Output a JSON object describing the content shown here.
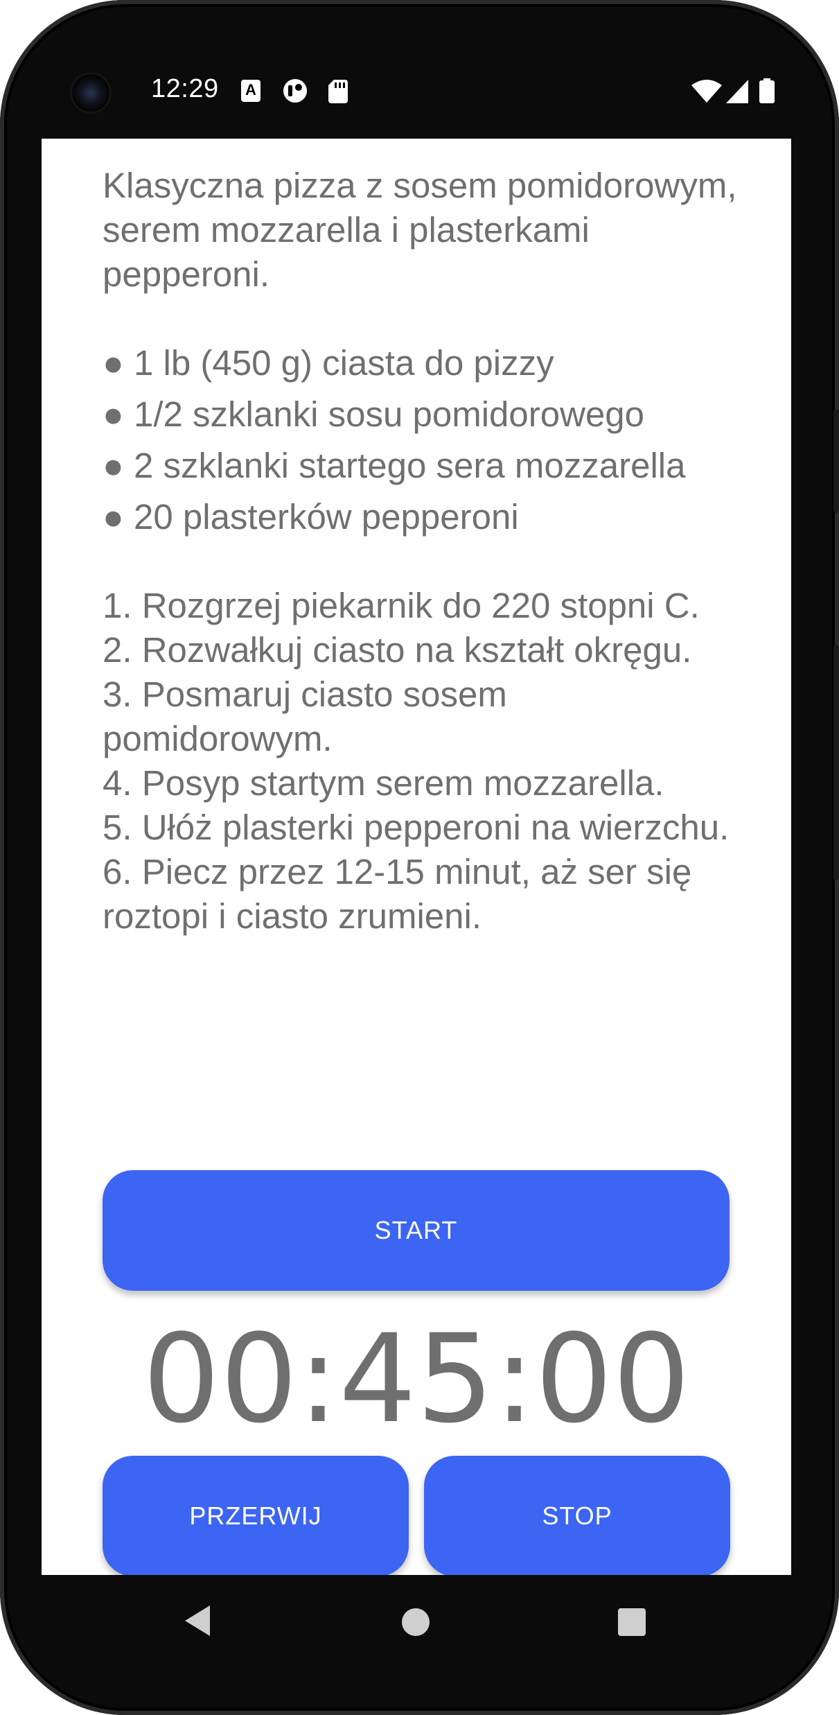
{
  "status_bar": {
    "time": "12:29",
    "icons": [
      "camera-icon",
      "a-icon",
      "sync-icon",
      "sd-card-icon",
      "wifi-icon",
      "signal-icon",
      "battery-icon"
    ],
    "a_letter": "A"
  },
  "recipe": {
    "description": "Klasyczna pizza z sosem pomidorowym, serem mozzarella i plasterkami pepperoni.",
    "ingredients": [
      "● 1 lb (450 g) ciasta do pizzy",
      "● 1/2 szklanki sosu pomidorowego",
      "● 2 szklanki startego sera mozzarella",
      "● 20 plasterków pepperoni"
    ],
    "steps": [
      "1. Rozgrzej piekarnik do 220 stopni C.",
      "2. Rozwałkuj ciasto na kształt okręgu.",
      "3. Posmaruj ciasto sosem pomidorowym.",
      "4. Posyp startym serem mozzarella.",
      "5. Ułóż plasterki pepperoni na wierzchu.",
      "6. Piecz przez 12-15 minut, aż ser się roztopi i ciasto zrumieni."
    ]
  },
  "timer": {
    "start_label": "START",
    "display": "00:45:00",
    "pause_label": "PRZERWIJ",
    "stop_label": "STOP"
  },
  "nav_bar": {
    "icons": [
      "back-icon",
      "home-icon",
      "recents-icon"
    ]
  },
  "colors": {
    "accent": "#3d65f3",
    "text": "#6f6f6f",
    "frame": "#0b0b0b"
  }
}
